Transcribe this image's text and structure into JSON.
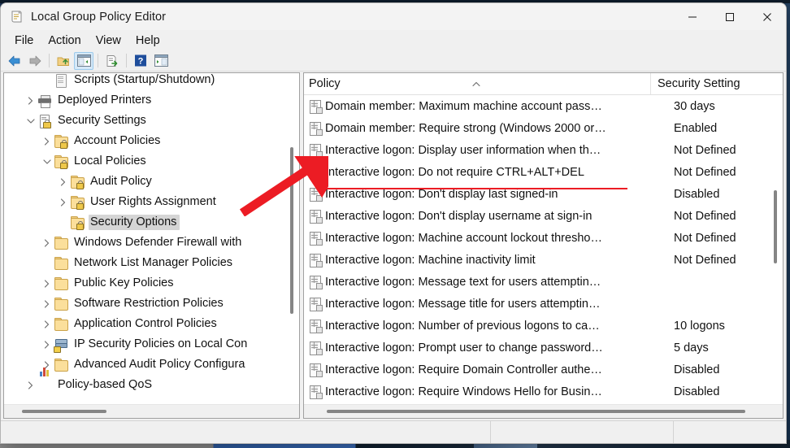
{
  "window": {
    "title": "Local Group Policy Editor",
    "app_icon": "policy-editor-icon",
    "minimize": "minimize-icon",
    "maximize": "maximize-icon",
    "close": "close-icon"
  },
  "menubar": {
    "items": [
      {
        "label": "File"
      },
      {
        "label": "Action"
      },
      {
        "label": "View"
      },
      {
        "label": "Help"
      }
    ]
  },
  "toolbar": {
    "buttons": [
      {
        "name": "back-icon",
        "title": "Back"
      },
      {
        "name": "forward-icon",
        "title": "Forward"
      },
      {
        "name": "up-one-level-icon",
        "title": "Up One Level"
      },
      {
        "name": "show-hide-console-tree-icon",
        "title": "Show/Hide Console Tree",
        "selected": true
      },
      {
        "name": "export-list-icon",
        "title": "Export List"
      },
      {
        "name": "help-icon",
        "title": "Help"
      },
      {
        "name": "show-hide-action-pane-icon",
        "title": "Show/Hide Action Pane"
      }
    ]
  },
  "tree": {
    "items": [
      {
        "label": "Scripts (Startup/Shutdown)",
        "indent": 2,
        "twisty": "none",
        "icon": "script-icon"
      },
      {
        "label": "Deployed Printers",
        "indent": 1,
        "twisty": "collapsed",
        "icon": "printer-icon"
      },
      {
        "label": "Security Settings",
        "indent": 1,
        "twisty": "expanded",
        "icon": "security-settings-icon"
      },
      {
        "label": "Account Policies",
        "indent": 2,
        "twisty": "collapsed",
        "icon": "folder-lock-icon"
      },
      {
        "label": "Local Policies",
        "indent": 2,
        "twisty": "expanded",
        "icon": "folder-lock-icon"
      },
      {
        "label": "Audit Policy",
        "indent": 3,
        "twisty": "collapsed",
        "icon": "folder-lock-icon"
      },
      {
        "label": "User Rights Assignment",
        "indent": 3,
        "twisty": "collapsed",
        "icon": "folder-lock-icon"
      },
      {
        "label": "Security Options",
        "indent": 3,
        "twisty": "none",
        "icon": "folder-lock-icon",
        "selected": true
      },
      {
        "label": "Windows Defender Firewall with",
        "indent": 2,
        "twisty": "collapsed",
        "icon": "folder-icon"
      },
      {
        "label": "Network List Manager Policies",
        "indent": 2,
        "twisty": "none",
        "icon": "folder-icon"
      },
      {
        "label": "Public Key Policies",
        "indent": 2,
        "twisty": "collapsed",
        "icon": "folder-icon"
      },
      {
        "label": "Software Restriction Policies",
        "indent": 2,
        "twisty": "collapsed",
        "icon": "folder-icon"
      },
      {
        "label": "Application Control Policies",
        "indent": 2,
        "twisty": "collapsed",
        "icon": "folder-icon"
      },
      {
        "label": "IP Security Policies on Local Con",
        "indent": 2,
        "twisty": "collapsed",
        "icon": "ipsec-icon"
      },
      {
        "label": "Advanced Audit Policy Configurа",
        "indent": 2,
        "twisty": "collapsed",
        "icon": "folder-icon"
      },
      {
        "label": "Policy-based QoS",
        "indent": 1,
        "twisty": "collapsed",
        "icon": "qos-icon"
      }
    ]
  },
  "list": {
    "columns": [
      {
        "label": "Policy",
        "sort": "ascending"
      },
      {
        "label": "Security Setting"
      }
    ],
    "rows": [
      {
        "policy": "Domain member: Maximum machine account pass…",
        "setting": "30 days"
      },
      {
        "policy": "Domain member: Require strong (Windows 2000 or…",
        "setting": "Enabled"
      },
      {
        "policy": "Interactive logon: Display user information when th…",
        "setting": "Not Defined"
      },
      {
        "policy": "Interactive logon: Do not require CTRL+ALT+DEL",
        "setting": "Not Defined",
        "annotated": true
      },
      {
        "policy": "Interactive logon: Don't display last signed-in",
        "setting": "Disabled"
      },
      {
        "policy": "Interactive logon: Don't display username at sign-in",
        "setting": "Not Defined"
      },
      {
        "policy": "Interactive logon: Machine account lockout thresho…",
        "setting": "Not Defined"
      },
      {
        "policy": "Interactive logon: Machine inactivity limit",
        "setting": "Not Defined"
      },
      {
        "policy": "Interactive logon: Message text for users attemptin…",
        "setting": ""
      },
      {
        "policy": "Interactive logon: Message title for users attemptin…",
        "setting": ""
      },
      {
        "policy": "Interactive logon: Number of previous logons to ca…",
        "setting": "10 logons"
      },
      {
        "policy": "Interactive logon: Prompt user to change password…",
        "setting": "5 days"
      },
      {
        "policy": "Interactive logon: Require Domain Controller authe…",
        "setting": "Disabled"
      },
      {
        "policy": "Interactive logon: Require Windows Hello for Busin…",
        "setting": "Disabled"
      }
    ]
  },
  "annotation": {
    "arrow_color": "#ec1c24",
    "underline_color": "#ec1c24",
    "target_row": "Interactive logon: Do not require CTRL+ALT+DEL"
  },
  "statusbar": {
    "main": "",
    "cell2": "",
    "cell3": ""
  },
  "colors": {
    "accent": "#0078d4",
    "selection": "#d5d5d5",
    "window_bg": "#f0f0f0",
    "pane_bg": "#ffffff"
  }
}
